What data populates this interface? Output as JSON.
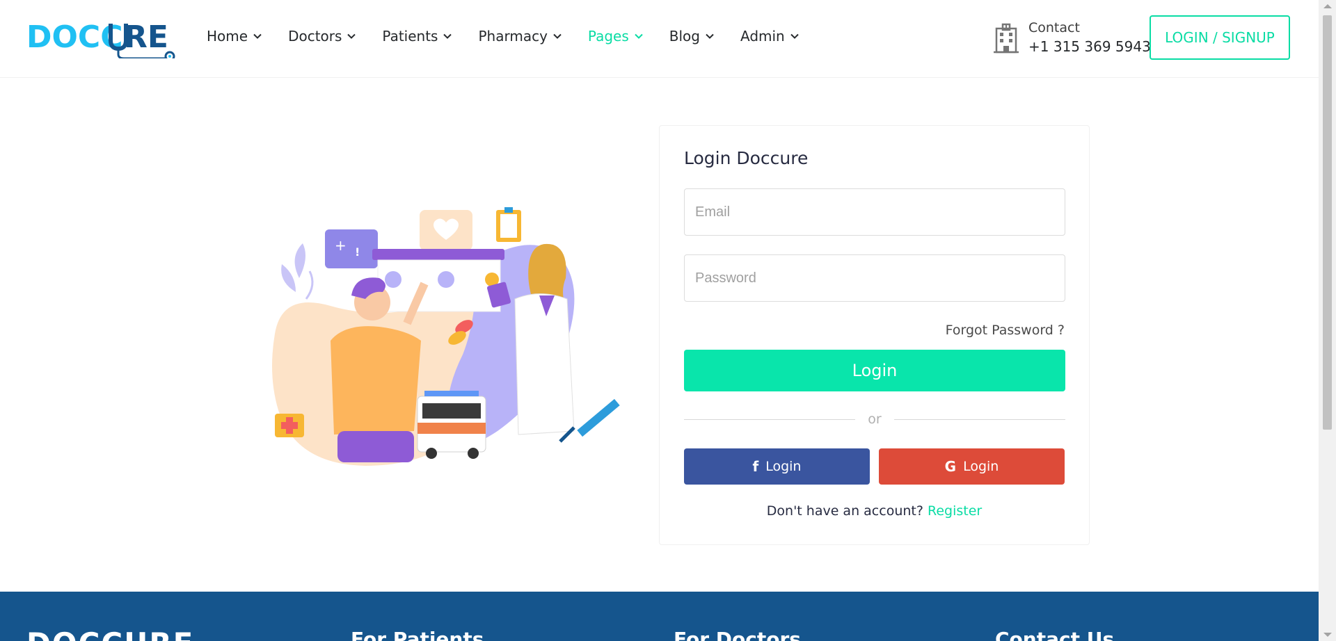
{
  "header": {
    "logo": "DOCCURE",
    "nav": [
      {
        "label": "Home",
        "active": false
      },
      {
        "label": "Doctors",
        "active": false
      },
      {
        "label": "Patients",
        "active": false
      },
      {
        "label": "Pharmacy",
        "active": false
      },
      {
        "label": "Pages",
        "active": true
      },
      {
        "label": "Blog",
        "active": false
      },
      {
        "label": "Admin",
        "active": false
      }
    ],
    "contact_label": "Contact",
    "contact_phone": "+1 315 369 5943",
    "login_signup": "LOGIN / SIGNUP"
  },
  "login": {
    "title": "Login Doccure",
    "email_placeholder": "Email",
    "password_placeholder": "Password",
    "forgot": "Forgot Password ?",
    "submit": "Login",
    "or": "or",
    "facebook": "Login",
    "google": "Login",
    "no_account": "Don't have an account?",
    "register": "Register"
  },
  "footer": {
    "logo": "DOCCURE",
    "columns": [
      "For Patients",
      "For Doctors",
      "Contact Us"
    ]
  },
  "colors": {
    "accent": "#09dca4",
    "brand_light": "#20c0f3",
    "brand_dark": "#15558d",
    "facebook": "#3a559f",
    "google": "#dd4b39"
  }
}
